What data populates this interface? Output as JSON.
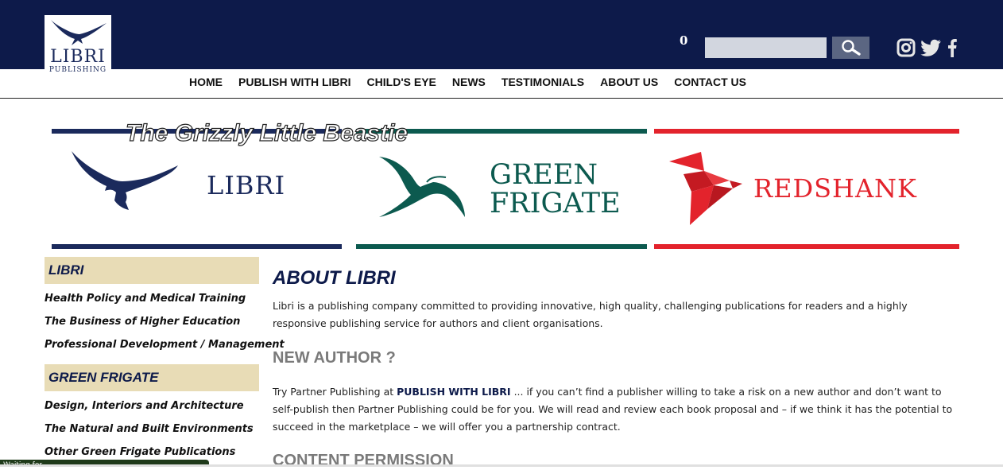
{
  "header": {
    "logo_word": "LIBRI",
    "logo_sub": "PUBLISHING",
    "cart_count": "0",
    "search_value": "",
    "search_placeholder": "",
    "social_icons": [
      "instagram-icon",
      "twitter-icon",
      "facebook-icon"
    ],
    "colors": {
      "bar": "#0d1a4a",
      "search_button": "#5b6682"
    }
  },
  "nav": {
    "items": [
      {
        "label": "HOME"
      },
      {
        "label": "PUBLISH WITH LIBRI"
      },
      {
        "label": "CHILD'S EYE"
      },
      {
        "label": "NEWS"
      },
      {
        "label": "TESTIMONIALS"
      },
      {
        "label": "ABOUT US"
      },
      {
        "label": "CONTACT US"
      }
    ]
  },
  "banner": {
    "title": "The Grizzly Little Beastie",
    "brands": [
      {
        "name": "LIBRI",
        "color": "#1b2a5c"
      },
      {
        "name_line1": "GREEN",
        "name_line2": "FRIGATE",
        "color": "#0c5a4f"
      },
      {
        "name": "REDSHANK",
        "color": "#e3232c"
      }
    ]
  },
  "sidebar": {
    "sections": [
      {
        "heading": "LIBRI",
        "links": [
          "Health Policy and Medical Training",
          "The Business of Higher Education",
          "Professional Development / Management"
        ]
      },
      {
        "heading": "GREEN FRIGATE",
        "links": [
          "Design, Interiors and Architecture",
          "The Natural and Built Environments",
          "Other Green Frigate Publications"
        ]
      }
    ]
  },
  "main": {
    "title": "ABOUT LIBRI",
    "intro": "Libri is a publishing company committed to providing innovative, high quality, challenging publications for readers and a highly responsive publishing service for authors and client organisations.",
    "new_author_heading": "NEW AUTHOR ?",
    "new_author_pre": "Try Partner Publishing at ",
    "new_author_link": "PUBLISH WITH LIBRI",
    "new_author_post": " ... if you can’t find a publisher willing to take a risk on a new author and don’t want to self-publish then Partner Publishing could be for you.   We will read and review each book proposal and – if we think it has the potential to succeed in the marketplace – we will offer you a partnership contract.",
    "content_permission_heading": "CONTENT PERMISSION"
  },
  "status_bar": {
    "text": "Waiting for ..."
  }
}
